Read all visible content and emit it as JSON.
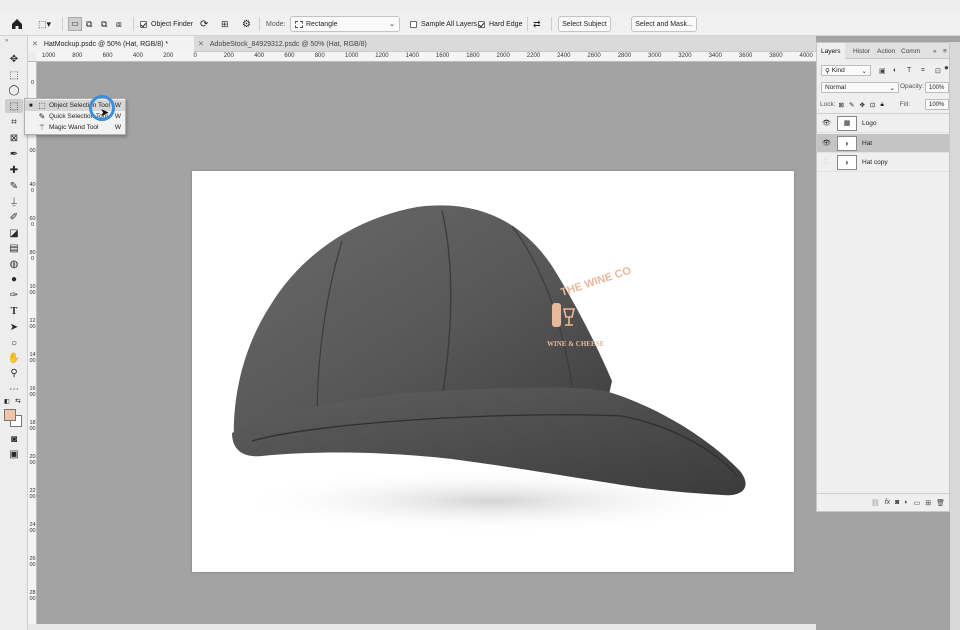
{
  "options_bar": {
    "object_finder_label": "Object Finder",
    "mode_label": "Mode:",
    "mode_value": "Rectangle",
    "sample_all_layers_label": "Sample All Layers",
    "hard_edge_label": "Hard Edge",
    "select_subject_label": "Select Subject",
    "select_and_mask_label": "Select and Mask...",
    "object_finder_checked": true,
    "sample_all_layers_checked": false,
    "hard_edge_checked": true
  },
  "tabs": [
    {
      "label": "HatMockup.psdc @ 50% (Hat, RGB/8) *",
      "active": true
    },
    {
      "label": "AdobeStock_84929312.psdc @ 50% (Hat, RGB/8)",
      "active": false
    }
  ],
  "ruler_top_ticks": [
    "1000",
    "800",
    "600",
    "400",
    "200",
    "0",
    "200",
    "400",
    "600",
    "800",
    "1000",
    "1200",
    "1400",
    "1600",
    "1800",
    "2000",
    "2200",
    "2400",
    "2600",
    "2800",
    "3000",
    "3200",
    "3400",
    "3600",
    "3800",
    "4000"
  ],
  "ruler_left_ticks": [
    "0",
    "2",
    "0 0",
    "4 0 0",
    "6 0 0",
    "8 0 0",
    "1 0 0 0",
    "1 2 0 0",
    "1 4 0 0",
    "1 6 0 0",
    "1 8 0 0",
    "2 0 0 0",
    "2 2 0 0",
    "2 4 0 0",
    "2 6 0 0",
    "2 8 0 0"
  ],
  "flyout": [
    {
      "label": "Object Selection Tool",
      "key": "W",
      "selected": true
    },
    {
      "label": "Quick Selection Tool",
      "key": "W",
      "selected": false
    },
    {
      "label": "Magic Wand Tool",
      "key": "W",
      "selected": false
    }
  ],
  "artwork": {
    "logo_arc_text": "THE WINE CO",
    "logo_sub_text": "WINE & CHEESE",
    "logo_color": "#e7b89a",
    "hat_color": "#555555"
  },
  "panel": {
    "tabs": [
      "Layers",
      "Histor",
      "Action",
      "Comm"
    ],
    "kind_label": "Kind",
    "blend_mode": "Normal",
    "opacity_label": "Opacity:",
    "opacity_value": "100%",
    "lock_label": "Lock:",
    "fill_label": "Fill:",
    "fill_value": "100%",
    "layers": [
      {
        "name": "Logo",
        "visible": true,
        "selected": false
      },
      {
        "name": "Hat",
        "visible": true,
        "selected": true
      },
      {
        "name": "Hat copy",
        "visible": false,
        "selected": false
      }
    ]
  },
  "colors": {
    "foreground": "#f2c4a8",
    "background": "#ffffff",
    "accent_ring": "#3a8fd9"
  }
}
